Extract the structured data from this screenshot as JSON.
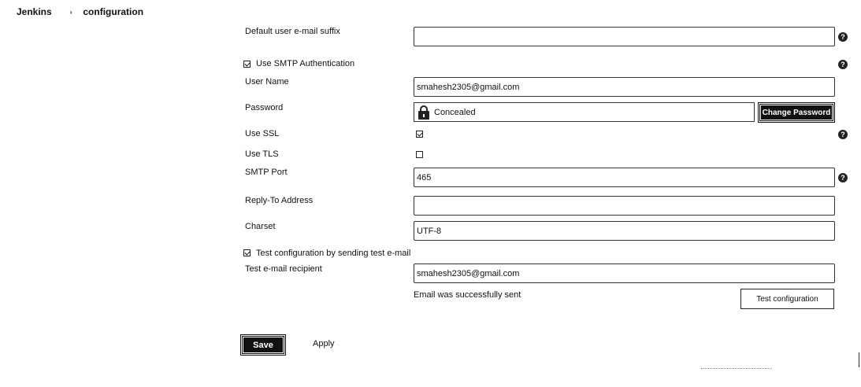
{
  "breadcrumb": {
    "root": "Jenkins",
    "separator": "›",
    "current": "configuration"
  },
  "form": {
    "default_suffix": {
      "label": "Default user e-mail suffix",
      "value": ""
    },
    "use_smtp_auth": {
      "label": "Use SMTP Authentication",
      "checked": true
    },
    "user_name": {
      "label": "User Name",
      "value": "smahesh2305@gmail.com"
    },
    "password": {
      "label": "Password",
      "value": "Concealed",
      "change_button": "Change Password"
    },
    "use_ssl": {
      "label": "Use SSL",
      "checked": true
    },
    "use_tls": {
      "label": "Use TLS",
      "checked": false
    },
    "smtp_port": {
      "label": "SMTP Port",
      "value": "465"
    },
    "reply_to": {
      "label": "Reply-To Address",
      "value": ""
    },
    "charset": {
      "label": "Charset",
      "value": "UTF-8"
    },
    "test_config": {
      "label": "Test configuration by sending test e-mail",
      "checked": true
    },
    "test_recipient": {
      "label": "Test e-mail recipient",
      "value": "smahesh2305@gmail.com"
    },
    "status_message": "Email was successfully sent",
    "test_button": "Test configuration"
  },
  "help_icon_glyph": "?",
  "actions": {
    "save": "Save",
    "apply": "Apply"
  }
}
